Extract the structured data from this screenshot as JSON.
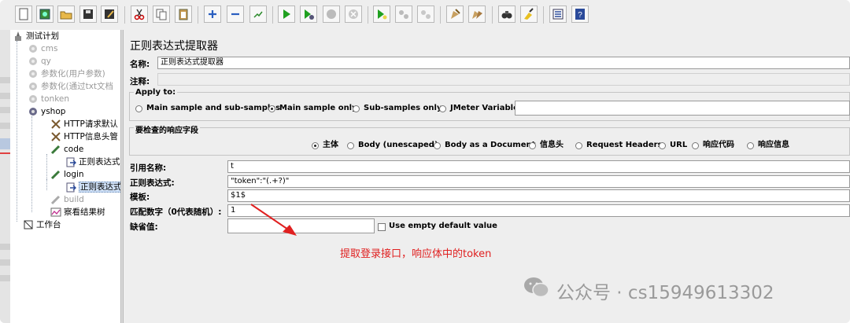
{
  "toolbar": {
    "buttons": [
      "new-icon",
      "templates-icon",
      "open-icon",
      "save-icon",
      "save-as-icon",
      "cut-icon",
      "copy-icon",
      "paste-icon",
      "expand-icon",
      "collapse-icon",
      "toggle-icon",
      "start-icon",
      "start-no-pause-icon",
      "stop-icon",
      "shutdown-icon",
      "remote-start-icon",
      "remote-stop-icon",
      "remote-shutdown-icon",
      "clear-icon",
      "clear-all-icon",
      "search-icon",
      "reset-search-icon",
      "function-helper-icon",
      "help-icon"
    ]
  },
  "tree": {
    "items": [
      {
        "label": "测试计划"
      },
      {
        "label": "cms"
      },
      {
        "label": "qy"
      },
      {
        "label": "参数化(用户参数)"
      },
      {
        "label": "参数化(通过txt文档"
      },
      {
        "label": "tonken"
      },
      {
        "label": "yshop"
      },
      {
        "label": "HTTP请求默认"
      },
      {
        "label": "HTTP信息头管"
      },
      {
        "label": "code"
      },
      {
        "label": "正则表达式"
      },
      {
        "label": "login"
      },
      {
        "label": "正则表达式"
      },
      {
        "label": "build"
      },
      {
        "label": "察看结果树"
      },
      {
        "label": "工作台"
      }
    ]
  },
  "panel": {
    "title": "正则表达式提取器",
    "name_label": "名称:",
    "name_value": "正则表达式提取器",
    "comment_label": "注释:",
    "apply_to": {
      "label": "Apply to:",
      "options": [
        "Main sample and sub-samples",
        "Main sample only",
        "Sub-samples only",
        "JMeter Variable"
      ],
      "selected": "Main sample only",
      "variable_value": ""
    },
    "response_field": {
      "label": "要检查的响应字段",
      "options": [
        "主体",
        "Body (unescaped)",
        "Body as a Document",
        "信息头",
        "Request Headers",
        "URL",
        "响应代码",
        "响应信息"
      ],
      "selected": "主体"
    },
    "ref_name_label": "引用名称:",
    "ref_name_value": "t",
    "regex_label": "正则表达式:",
    "regex_value": "\"token\":\"(.+?)\"",
    "template_label": "模板:",
    "template_value": "$1$",
    "match_label": "匹配数字（0代表随机）:",
    "match_value": "1",
    "default_label": "缺省值:",
    "default_value": "",
    "use_empty_label": "Use empty default value",
    "use_empty_checked": false
  },
  "annotation": "提取登录接口，响应体中的token",
  "watermark": "公众号 · cs15949613302",
  "colors": {
    "annotation": "#e02020",
    "arrow": "#e02020",
    "selection": "#cfe0f6"
  }
}
